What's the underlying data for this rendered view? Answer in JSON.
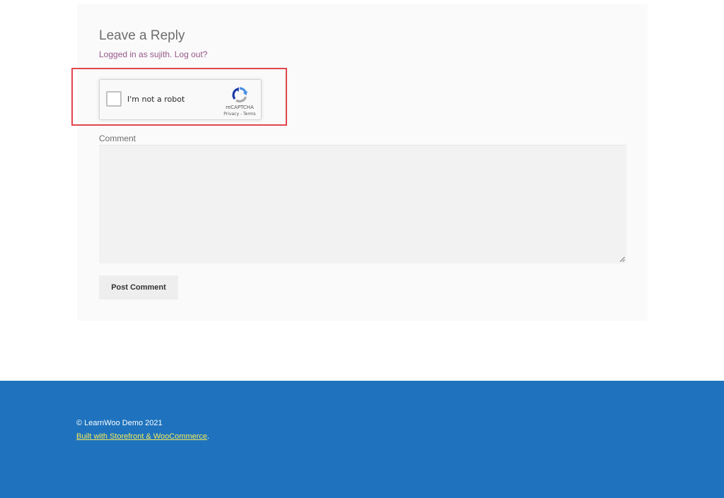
{
  "comments": {
    "title": "Leave a Reply",
    "logged_in_prefix": "Logged in as sujith.",
    "logout_link": "Log out?",
    "comment_label": "Comment",
    "comment_value": "",
    "submit_label": "Post Comment"
  },
  "recaptcha": {
    "label": "I'm not a robot",
    "brand": "reCAPTCHA",
    "privacy": "Privacy",
    "separator": " - ",
    "terms": "Terms",
    "checked": false,
    "logo_icon": "recaptcha-logo-icon"
  },
  "footer": {
    "copyright": "© LearnWoo Demo 2021",
    "credit_link": "Built with Storefront & WooCommerce",
    "credit_suffix": ".",
    "background_color": "#1f73be",
    "link_color": "#f4e95b"
  },
  "colors": {
    "highlight_frame": "#e0464c",
    "accent_link": "#96588a"
  }
}
